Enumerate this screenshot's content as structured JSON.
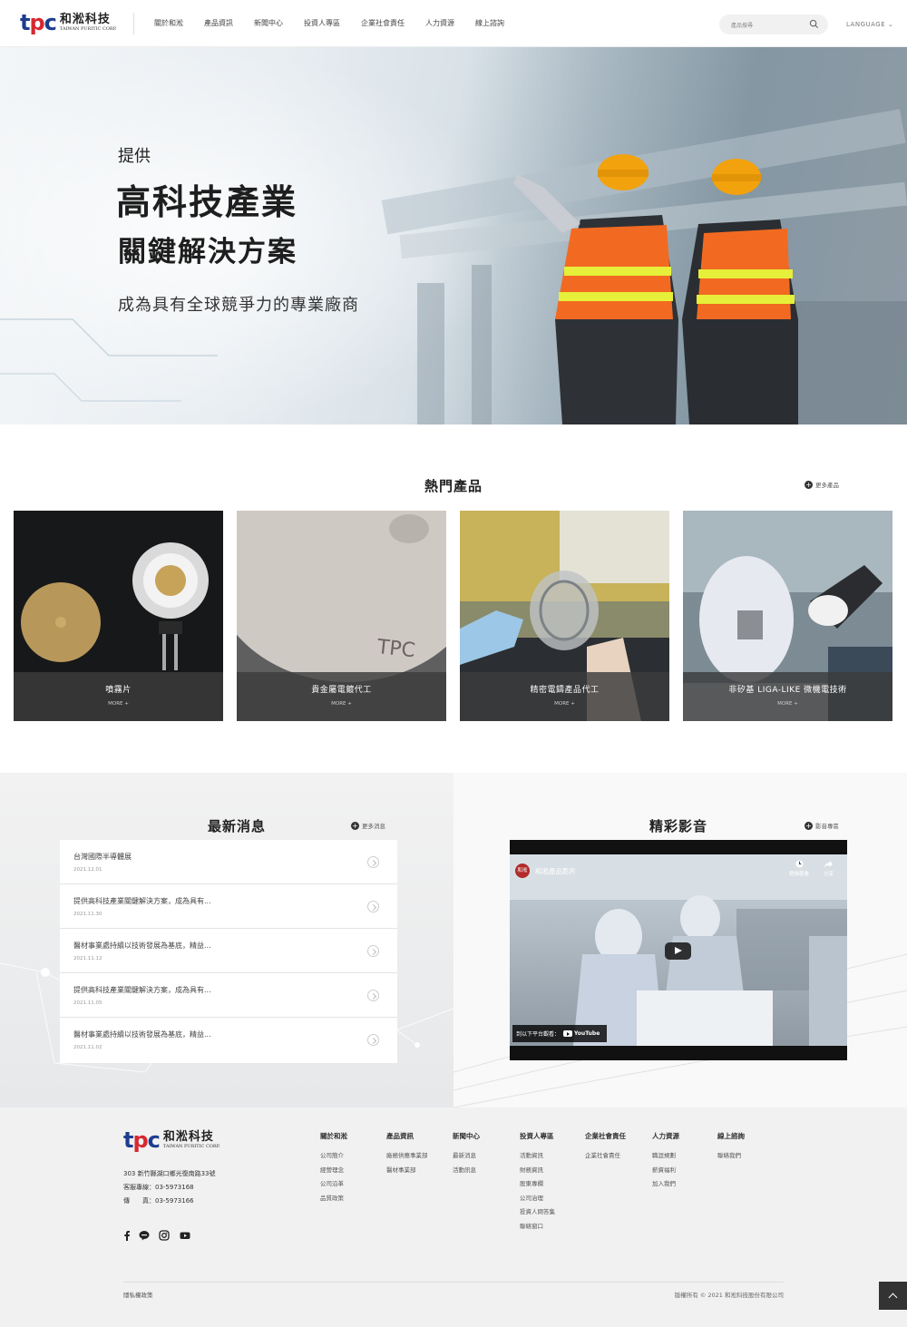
{
  "header": {
    "logo_zh": "和淞科技",
    "logo_en": "TAIWAN PURITIC CORP.",
    "nav": [
      "關於和淞",
      "產品資訊",
      "新聞中心",
      "投資人專區",
      "企業社會責任",
      "人力資源",
      "線上諮詢"
    ],
    "search_placeholder": "產品搜尋",
    "language": "LANGUAGE"
  },
  "hero": {
    "line1": "提供",
    "line2": "高科技產業",
    "line3": "關鍵解決方案",
    "line4": "成為具有全球競爭力的專業廠商"
  },
  "products": {
    "title": "熱門產品",
    "more": "更多產品",
    "items": [
      {
        "name": "噴霧片",
        "more": "MORE +"
      },
      {
        "name": "貴金屬電鍍代工",
        "more": "MORE +"
      },
      {
        "name": "精密電鑄產品代工",
        "more": "MORE +"
      },
      {
        "name": "非矽基 LIGA-LIKE 微機電技術",
        "more": "MORE +"
      }
    ]
  },
  "news": {
    "title": "最新消息",
    "more": "更多消息",
    "items": [
      {
        "title": "台灣國際半導體展",
        "date": "2021.12.01"
      },
      {
        "title": "提供高科技產業關鍵解決方案，成為具有...",
        "date": "2021.11.30"
      },
      {
        "title": "醫材事業處持續以技術發展為基底，精益...",
        "date": "2021.11.12"
      },
      {
        "title": "提供高科技產業關鍵解決方案，成為具有...",
        "date": "2021.11.05"
      },
      {
        "title": "醫材事業處持續以技術發展為基底，精益...",
        "date": "2021.11.02"
      }
    ]
  },
  "video": {
    "title": "精彩影音",
    "more": "影音專區",
    "channel_avatar": "和淞",
    "video_title": "和淞產品影片",
    "watch_later": "稍後觀看",
    "share": "分享",
    "watch_on": "到以下平台觀看：",
    "platform": "YouTube"
  },
  "footer": {
    "logo_zh": "和淞科技",
    "logo_en": "TAIWAN PURITIC CORP.",
    "address": "303 新竹縣湖口鄉光復南路33號",
    "service_line": "客服專線：03-5973168",
    "fax": "傳　　真：03-5973166",
    "columns": [
      {
        "head": "關於和淞",
        "links": [
          "公司簡介",
          "經營理念",
          "公司沿革",
          "品質政策"
        ]
      },
      {
        "head": "產品資訊",
        "links": [
          "廠務供應事業部",
          "醫材事業部"
        ]
      },
      {
        "head": "新聞中心",
        "links": [
          "最新消息",
          "活動訊息"
        ]
      },
      {
        "head": "投資人專區",
        "links": [
          "活動資訊",
          "財務資訊",
          "股東專欄",
          "公司治理",
          "投資人問答集",
          "聯絡窗口"
        ]
      },
      {
        "head": "企業社會責任",
        "links": [
          "企業社會責任"
        ]
      },
      {
        "head": "人力資源",
        "links": [
          "職涯規劃",
          "薪資福利",
          "加入我們"
        ]
      },
      {
        "head": "線上諮詢",
        "links": [
          "聯絡我們"
        ]
      }
    ],
    "privacy": "隱私權政策",
    "copyright": "版權所有 © 2021 和淞科技股份有限公司"
  },
  "colors": {
    "brand_blue": "#1c3d8f",
    "brand_red": "#d7282f",
    "dark": "#333333"
  }
}
